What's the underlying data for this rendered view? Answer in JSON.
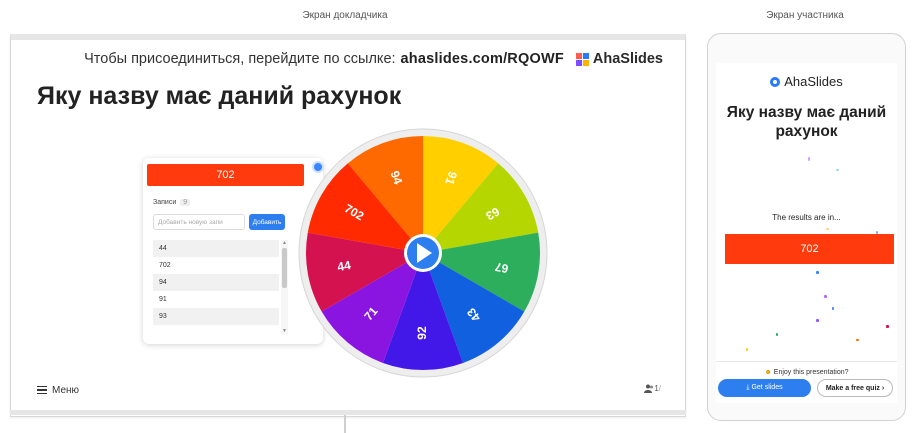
{
  "captions": {
    "presenter": "Экран докладчика",
    "participant": "Экран участника"
  },
  "presenter": {
    "join_text": "Чтобы присоединиться, перейдите по ссылке:",
    "join_url": "ahaslides.com/RQOWF",
    "brand": "AhaSlides",
    "title": "Яку назву має даний рахунок",
    "result": "702",
    "entries_label": "Записи",
    "entries_count": "9",
    "add_placeholder": "Добавить новую запи",
    "add_button": "Добавить",
    "entries": [
      "44",
      "702",
      "94",
      "91",
      "93"
    ],
    "wheel_labels": [
      "94",
      "91",
      "63",
      "67",
      "43",
      "92",
      "71",
      "44",
      "702"
    ],
    "wheel_colors": [
      "#ff6a00",
      "#ffcf00",
      "#b5d600",
      "#2cae5c",
      "#1060e0",
      "#4218e8",
      "#8b15e0",
      "#d4124f",
      "#ff2a00"
    ],
    "menu_label": "Меню",
    "audience_count": "1",
    "audience_total": "/"
  },
  "participant": {
    "brand": "AhaSlides",
    "title": "Яку назву має даний рахунок",
    "results_text": "The results are in...",
    "result": "702",
    "enjoy": "Enjoy this presentation?",
    "get_slides": "Get slides",
    "free_quiz": "Make a free quiz ›"
  }
}
